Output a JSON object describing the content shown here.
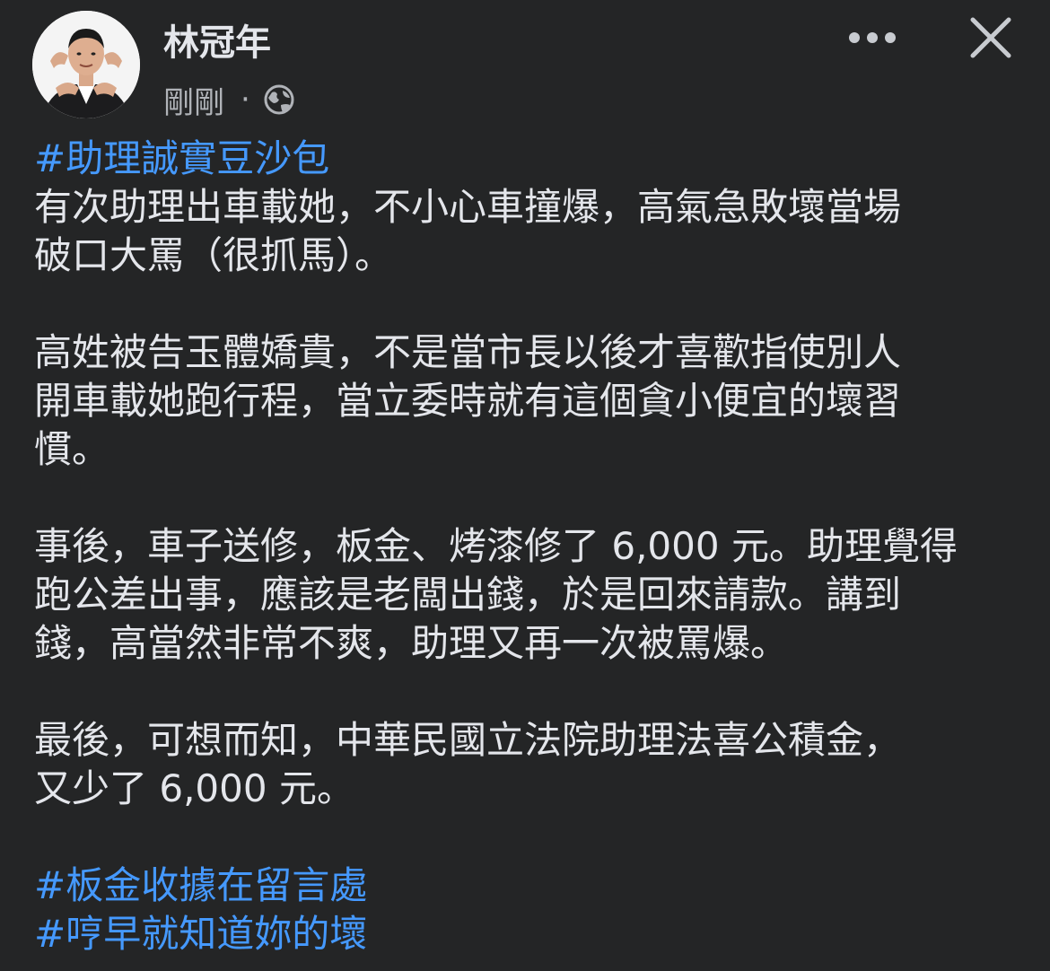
{
  "post": {
    "author": "林冠年",
    "timestamp": "剛剛",
    "separator": "·",
    "privacy_icon": "globe-icon",
    "more_icon": "more-horizontal-icon",
    "close_icon": "close-icon",
    "hashtag_1": "#助理誠實豆沙包",
    "paragraph_1_line_1": "有次助理出車載她，不小心車撞爆，高氣急敗壞當場",
    "paragraph_1_line_2": "破口大罵（很抓馬）。",
    "paragraph_2_line_1": "高姓被告玉體嬌貴，不是當市長以後才喜歡指使別人",
    "paragraph_2_line_2": "開車載她跑行程，當立委時就有這個貪小便宜的壞習",
    "paragraph_2_line_3": "慣。",
    "paragraph_3_line_1": "事後，車子送修，板金、烤漆修了 6,000 元。助理覺得",
    "paragraph_3_line_2": "跑公差出事，應該是老闆出錢，於是回來請款。講到",
    "paragraph_3_line_3": "錢，高當然非常不爽，助理又再一次被罵爆。",
    "paragraph_4_line_1": "最後，可想而知，中華民國立法院助理法喜公積金，",
    "paragraph_4_line_2": "又少了 6,000 元。",
    "hashtag_2": "#板金收據在留言處",
    "hashtag_3": "#哼早就知道妳的壞"
  },
  "colors": {
    "background": "#242526",
    "text": "#e4e6eb",
    "secondary_text": "#b0b3b8",
    "hashtag": "#4599ff"
  }
}
